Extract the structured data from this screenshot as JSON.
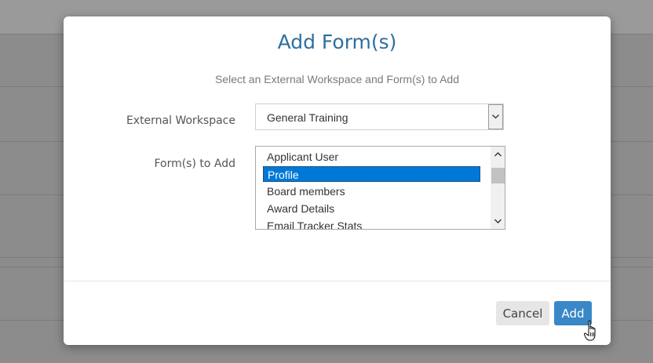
{
  "modal": {
    "title": "Add Form(s)",
    "subtitle": "Select an External Workspace and Form(s) to Add"
  },
  "form": {
    "workspace_label": "External Workspace",
    "workspace_value": "General Training",
    "forms_label": "Form(s) to Add",
    "forms_options": [
      {
        "label": "Applicant User",
        "selected": false
      },
      {
        "label": "Profile",
        "selected": true
      },
      {
        "label": "Board members",
        "selected": false
      },
      {
        "label": "Award Details",
        "selected": false
      },
      {
        "label": "Email Tracker Stats",
        "selected": false
      }
    ]
  },
  "footer": {
    "cancel_label": "Cancel",
    "add_label": "Add"
  },
  "colors": {
    "title": "#2f6f9f",
    "primary_button": "#3a87c8",
    "selection": "#0078d7"
  },
  "icons": {
    "dropdown": "chevron-down-icon",
    "scroll_up": "scroll-up-arrow-icon",
    "scroll_down": "scroll-down-arrow-icon",
    "cursor": "hand-pointer-icon"
  }
}
